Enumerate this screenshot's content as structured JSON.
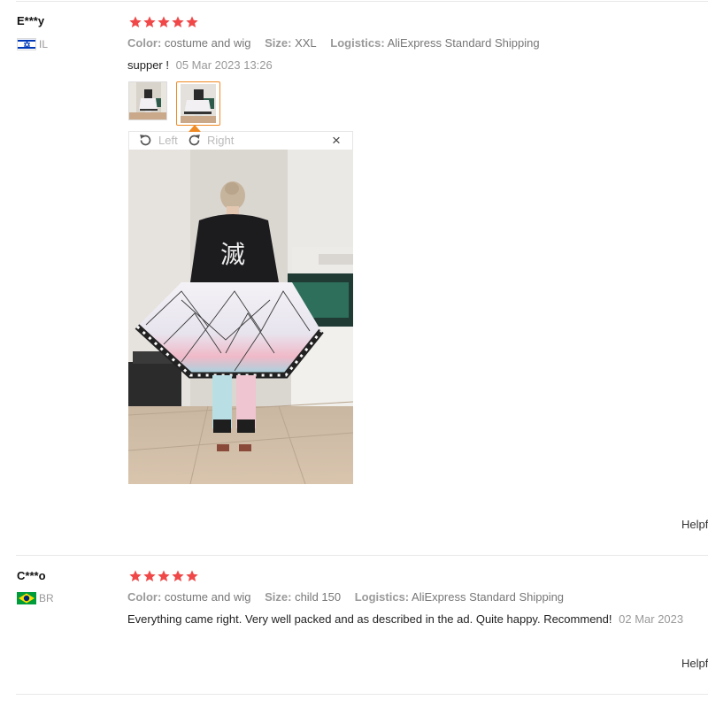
{
  "reviews": [
    {
      "user": "E***y",
      "country": "IL",
      "rating": 5,
      "color_label": "Color:",
      "color_value": "costume and wig",
      "size_label": "Size:",
      "size_value": "XXL",
      "logistics_label": "Logistics:",
      "logistics_value": "AliExpress Standard Shipping",
      "feedback": "supper !",
      "date": "05 Mar 2023 13:26",
      "helpful": "Helpf"
    },
    {
      "user": "C***o",
      "country": "BR",
      "rating": 5,
      "color_label": "Color:",
      "color_value": "costume and wig",
      "size_label": "Size:",
      "size_value": "child 150",
      "logistics_label": "Logistics:",
      "logistics_value": "AliExpress Standard Shipping",
      "feedback": "Everything came right. Very well packed and as described in the ad. Quite happy. Recommend!",
      "date": "02 Mar 2023",
      "helpful": "Helpf"
    }
  ],
  "viewer": {
    "rotate_left": "Left",
    "rotate_right": "Right",
    "close": "×",
    "selected_thumb": 2
  },
  "colors": {
    "star": "#f04848",
    "accent": "#f08a24",
    "israel_blue": "#0038b8",
    "brazil_green": "#009c3b",
    "brazil_yellow": "#ffdf00",
    "brazil_blue": "#002776"
  },
  "icons": [
    "star-icon",
    "rotate-left-icon",
    "rotate-right-icon",
    "close-icon"
  ]
}
